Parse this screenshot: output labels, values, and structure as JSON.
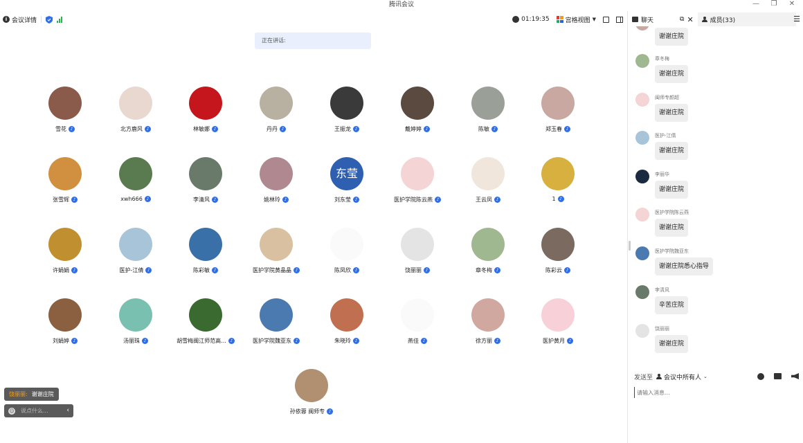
{
  "app": {
    "title": "腾讯会议"
  },
  "window_controls": [
    "—",
    "❐",
    "✕"
  ],
  "toolbar": {
    "meeting_details": "会议详情",
    "timer": "01:19:35",
    "view_mode": "宫格视图"
  },
  "speaking": {
    "label": "正在讲话:"
  },
  "participants": [
    {
      "name": "雪花",
      "color": "#8a5a4a"
    },
    {
      "name": "北方鹿风",
      "color": "#e8d8d0"
    },
    {
      "name": "林敏娜",
      "color": "#c4161c"
    },
    {
      "name": "丹丹",
      "color": "#b8b0a0"
    },
    {
      "name": "王振龙",
      "color": "#3a3a3a"
    },
    {
      "name": "戴婷婷",
      "color": "#5a4a40"
    },
    {
      "name": "陈敏",
      "color": "#9aa098"
    },
    {
      "name": "郑玉春",
      "color": "#c8a8a0"
    },
    {
      "name": "张雪辉",
      "color": "#d09040"
    },
    {
      "name": "xwh666",
      "color": "#5a7a50"
    },
    {
      "name": "李清风",
      "color": "#6a7a6a"
    },
    {
      "name": "姚林玲",
      "color": "#b08890"
    },
    {
      "name": "刘东莹",
      "color": "#2f5fb0",
      "text": "东莹"
    },
    {
      "name": "医护学院陈云燕",
      "color": "#f4d4d4"
    },
    {
      "name": "王云凤",
      "color": "#f0e6dc"
    },
    {
      "name": "1",
      "color": "#d8b040"
    },
    {
      "name": "许娟娟",
      "color": "#c09030"
    },
    {
      "name": "医护-江倩",
      "color": "#a8c4d8"
    },
    {
      "name": "陈彩敏",
      "color": "#3a70a8"
    },
    {
      "name": "医护学院黄晶晶",
      "color": "#d8c0a0"
    },
    {
      "name": "陈凤欣",
      "color": "#ffffff"
    },
    {
      "name": "饶丽丽",
      "color": "#e4e4e4"
    },
    {
      "name": "章冬梅",
      "color": "#a0b890"
    },
    {
      "name": "陈彩云",
      "color": "#7a6a60"
    },
    {
      "name": "刘娟婷",
      "color": "#8a6040"
    },
    {
      "name": "汤丽珠",
      "color": "#7ac0b0"
    },
    {
      "name": "胡雪梅闽江师范高...",
      "color": "#3a6a30"
    },
    {
      "name": "医护学院魏亚东",
      "color": "#4a7ab0"
    },
    {
      "name": "朱晓玲",
      "color": "#c07050"
    },
    {
      "name": "燕佳",
      "color": "#ffffff"
    },
    {
      "name": "徐方丽",
      "color": "#d0a8a0"
    },
    {
      "name": "医护黄月",
      "color": "#f8d0d8"
    },
    {
      "name": "孙依蓉 闽师专",
      "color": "#b09070"
    }
  ],
  "toast": {
    "who": "饶丽丽:",
    "text": "谢谢庄院"
  },
  "say_box": {
    "placeholder": "说点什么..."
  },
  "chat": {
    "tab_chat": "聊天",
    "tab_members": "成员(33)",
    "messages": [
      {
        "sender": "",
        "text": "谢谢庄院",
        "color": "#c8a8a0"
      },
      {
        "sender": "章冬梅",
        "text": "谢谢庄院",
        "color": "#a0b890"
      },
      {
        "sender": "闽师专颜超",
        "text": "谢谢庄院",
        "color": "#f4d4d4"
      },
      {
        "sender": "医护-江倩",
        "text": "谢谢庄院",
        "color": "#a8c4d8"
      },
      {
        "sender": "李丽华",
        "text": "谢谢庄院",
        "color": "#1a2a40"
      },
      {
        "sender": "医护学院陈云燕",
        "text": "谢谢庄院",
        "color": "#f4d4d4"
      },
      {
        "sender": "医护学院魏亚东",
        "text": "谢谢庄院悉心指导",
        "color": "#4a7ab0"
      },
      {
        "sender": "李清风",
        "text": "辛苦庄院",
        "color": "#6a7a6a"
      },
      {
        "sender": "饶丽丽",
        "text": "谢谢庄院",
        "color": "#e4e4e4"
      }
    ],
    "send_to_label": "发送至",
    "send_target": "会议中所有人",
    "input_placeholder": "请输入消息..."
  }
}
